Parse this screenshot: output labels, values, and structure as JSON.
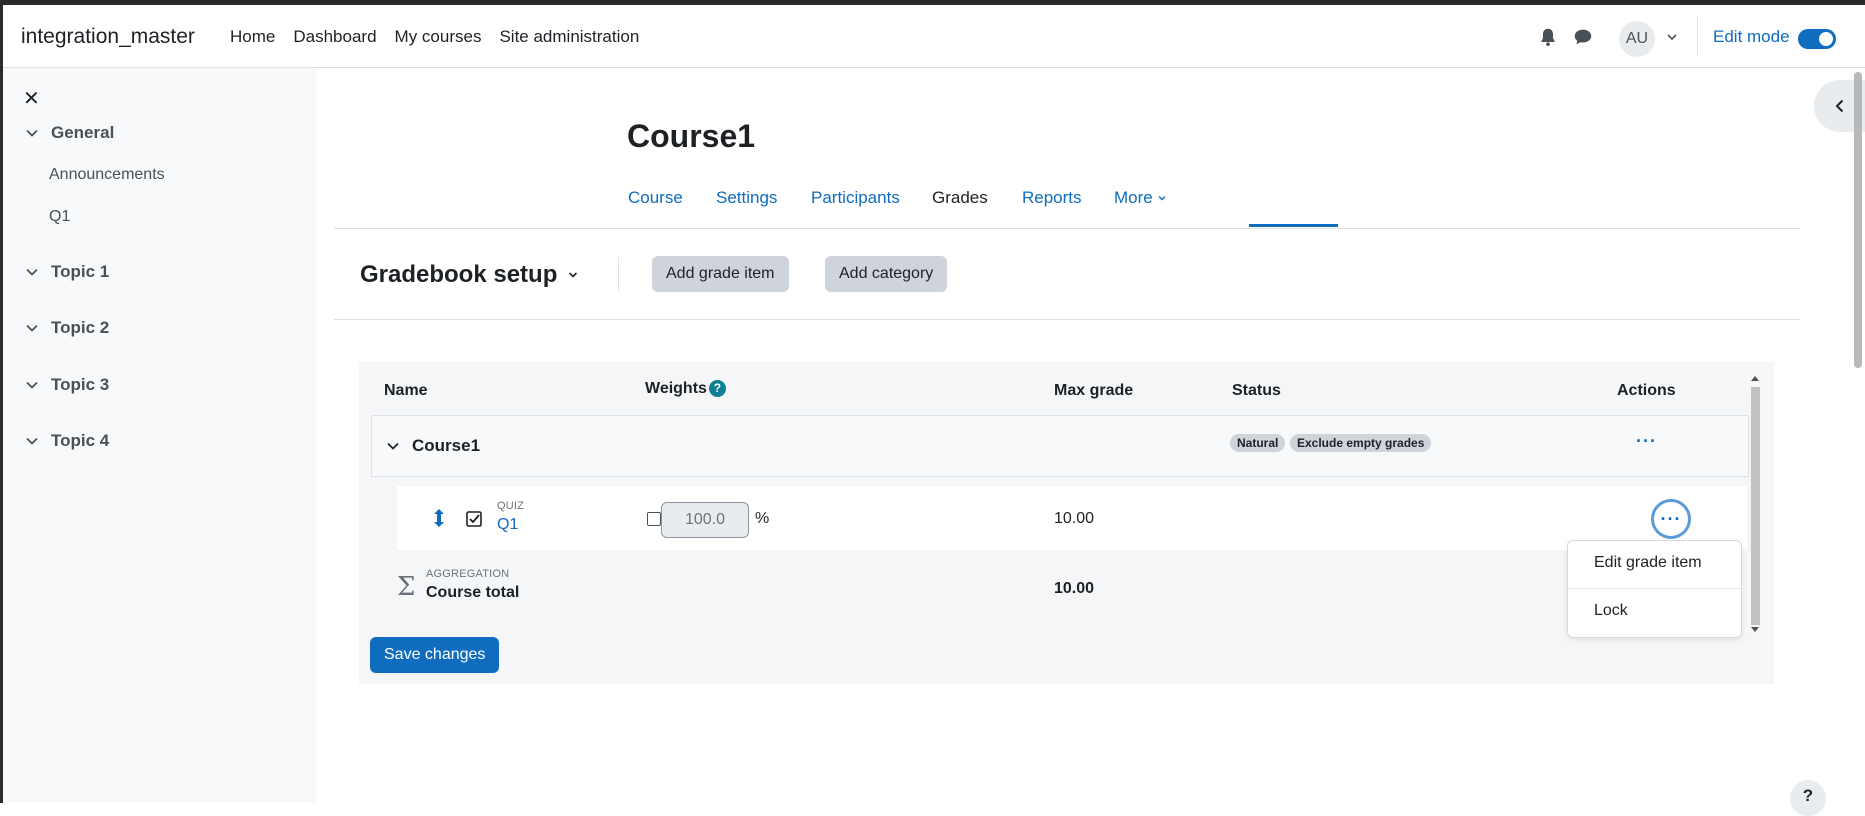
{
  "navbar": {
    "site_name": "integration_master",
    "links": [
      "Home",
      "Dashboard",
      "My courses",
      "Site administration"
    ],
    "avatar_initials": "AU",
    "edit_mode_label": "Edit mode",
    "edit_mode_on": true
  },
  "drawer": {
    "close_icon": "close-icon",
    "sections": [
      {
        "title": "General",
        "activities": [
          "Announcements",
          "Q1"
        ]
      },
      {
        "title": "Topic 1",
        "activities": []
      },
      {
        "title": "Topic 2",
        "activities": []
      },
      {
        "title": "Topic 3",
        "activities": []
      },
      {
        "title": "Topic 4",
        "activities": []
      }
    ]
  },
  "course": {
    "title": "Course1",
    "tabs": [
      "Course",
      "Settings",
      "Participants",
      "Grades",
      "Reports",
      "More"
    ],
    "active_tab": "Grades"
  },
  "gradebook": {
    "title": "Gradebook setup",
    "add_grade_item_label": "Add grade item",
    "add_category_label": "Add category",
    "columns": {
      "name": "Name",
      "weights": "Weights",
      "max_grade": "Max grade",
      "status": "Status",
      "actions": "Actions"
    },
    "weights_help": "?",
    "category": {
      "name": "Course1",
      "badges": [
        "Natural",
        "Exclude empty grades"
      ]
    },
    "item": {
      "type": "QUIZ",
      "name": "Q1",
      "weight": "100.0",
      "weight_unit": "%",
      "max_grade": "10.00"
    },
    "total": {
      "type": "AGGREGATION",
      "name": "Course total",
      "max_grade": "10.00"
    },
    "save_label": "Save changes",
    "actions_menu": [
      "Edit grade item",
      "Lock"
    ]
  },
  "colors": {
    "accent": "#0f6cbf",
    "badge_bg": "#ced4da",
    "drawer_bg": "#f8f9fa"
  }
}
